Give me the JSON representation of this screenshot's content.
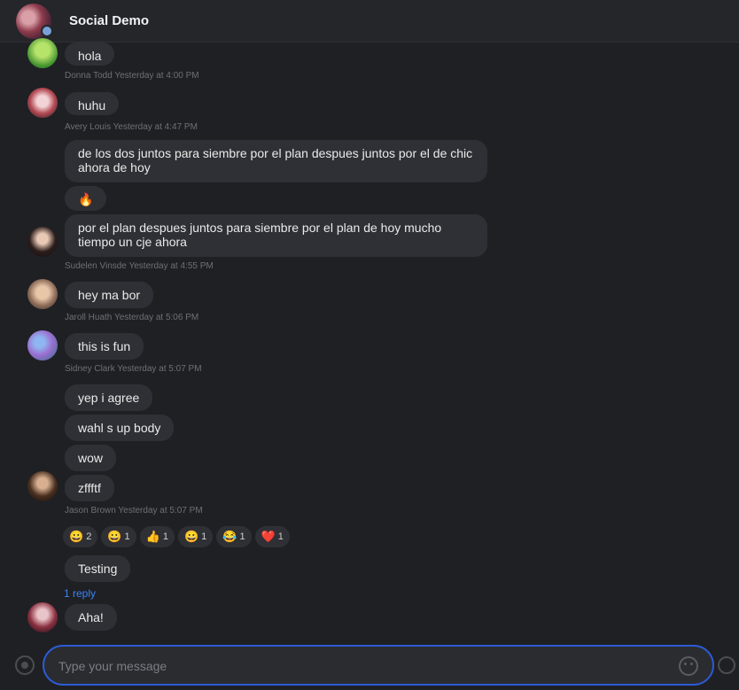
{
  "header": {
    "title": "Social Demo"
  },
  "messages": [
    {
      "text": "hola",
      "meta": "Donna Todd  Yesterday at 4:00 PM"
    },
    {
      "text": "huhu",
      "meta": "Avery Louis  Yesterday at 4:47 PM"
    },
    {
      "text": "de los dos juntos para siembre por el plan despues juntos por el de chic ahora de hoy"
    },
    {
      "text": "🔥"
    },
    {
      "text": "por el plan despues juntos para siembre por el plan de hoy mucho tiempo un cje ahora",
      "meta": "Sudelen Vinsde  Yesterday at 4:55 PM"
    },
    {
      "text": "hey ma bor",
      "meta": "Jaroll Huath  Yesterday at 5:06 PM"
    },
    {
      "text": "this is fun",
      "meta": "Sidney Clark  Yesterday at 5:07 PM"
    },
    {
      "text": "yep i agree"
    },
    {
      "text": "wahl s up body"
    },
    {
      "text": "wow"
    },
    {
      "text": "zffftf",
      "meta": "Jason Brown  Yesterday at 5:07 PM"
    },
    {
      "text": "Testing"
    },
    {
      "text": "Aha!"
    }
  ],
  "reactions": [
    {
      "emoji": "😀",
      "count": "2"
    },
    {
      "emoji": "😀",
      "count": "1"
    },
    {
      "emoji": "👍",
      "count": "1"
    },
    {
      "emoji": "😀",
      "count": "1"
    },
    {
      "emoji": "😂",
      "count": "1"
    },
    {
      "emoji": "❤️",
      "count": "1"
    }
  ],
  "replies_link": "1 reply",
  "composer": {
    "placeholder": "Type your message"
  },
  "icons": {
    "attach": "paperclip-icon",
    "emoji": "smiley-icon",
    "send": "send-icon"
  },
  "colors": {
    "accent": "#2d5bd6",
    "link": "#3b82f6",
    "bubble": "#2e3035",
    "background": "#1f2023"
  }
}
